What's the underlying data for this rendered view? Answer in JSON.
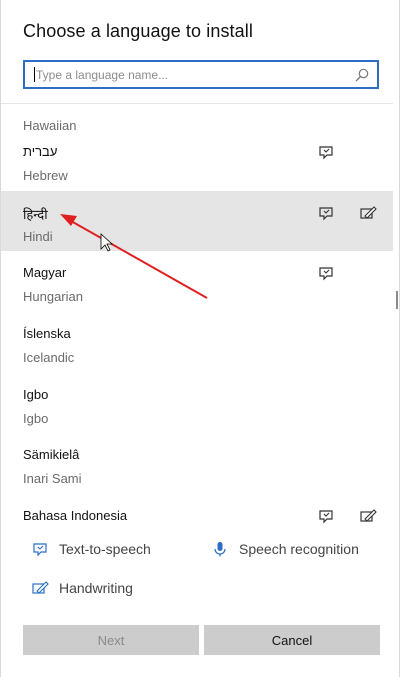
{
  "dialog": {
    "title": "Choose a language to install",
    "search": {
      "placeholder": "Type a language name...",
      "value": ""
    }
  },
  "languages": [
    {
      "native": "",
      "english": "Hawaiian",
      "speech_synthesis": false,
      "handwriting": false
    },
    {
      "native": "עברית",
      "english": "Hebrew",
      "speech_synthesis": true,
      "handwriting": false
    },
    {
      "native": "हिन्दी",
      "english": "Hindi",
      "speech_synthesis": true,
      "handwriting": true,
      "selected": true
    },
    {
      "native": "Magyar",
      "english": "Hungarian",
      "speech_synthesis": true,
      "handwriting": false
    },
    {
      "native": "Íslenska",
      "english": "Icelandic",
      "speech_synthesis": false,
      "handwriting": false
    },
    {
      "native": "Igbo",
      "english": "Igbo",
      "speech_synthesis": false,
      "handwriting": false
    },
    {
      "native": "Sämikielâ",
      "english": "Inari Sami",
      "speech_synthesis": false,
      "handwriting": false
    },
    {
      "native": "Bahasa Indonesia",
      "english": "",
      "speech_synthesis": true,
      "handwriting": true
    }
  ],
  "legend": {
    "text_to_speech": "Text-to-speech",
    "speech_recognition": "Speech recognition",
    "handwriting": "Handwriting"
  },
  "buttons": {
    "next": "Next",
    "cancel": "Cancel"
  },
  "colors": {
    "accent": "#2b6fc4",
    "arrow": "#e02020",
    "selected_row": "#e5e5e5"
  }
}
